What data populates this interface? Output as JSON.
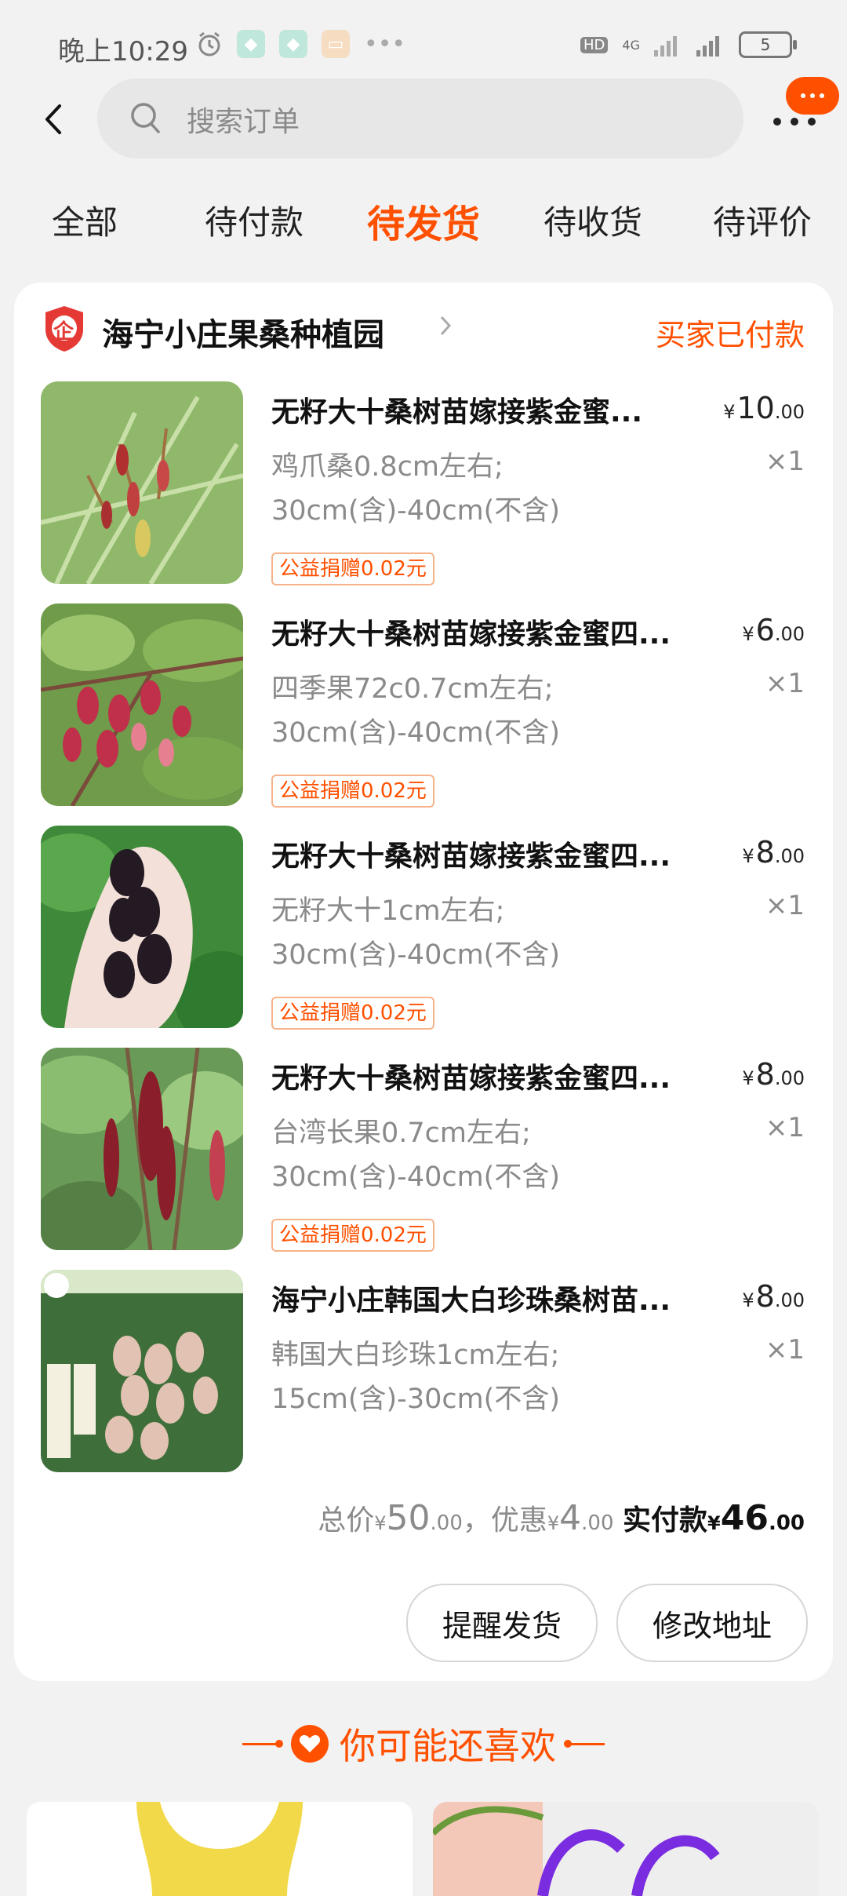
{
  "status_bar": {
    "time": "晚上10:29",
    "network_hd": "HD",
    "network_4g": "4G",
    "battery": "5"
  },
  "search": {
    "placeholder": "搜索订单"
  },
  "tabs": [
    {
      "label": "全部"
    },
    {
      "label": "待付款"
    },
    {
      "label": "待发货",
      "active": true
    },
    {
      "label": "待收货"
    },
    {
      "label": "待评价"
    }
  ],
  "order": {
    "shop_badge": "企",
    "shop_name": "海宁小庄果桑种植园",
    "status": "买家已付款",
    "items": [
      {
        "title": "无籽大十桑树苗嫁接紫金蜜...",
        "price_int": "10",
        "price_dec": ".00",
        "sku1": "鸡爪桑0.8cm左右;",
        "sku2": "30cm(含)-40cm(不含)",
        "qty": "×1",
        "donation": "公益捐赠0.02元"
      },
      {
        "title": "无籽大十桑树苗嫁接紫金蜜四...",
        "price_int": "6",
        "price_dec": ".00",
        "sku1": "四季果72c0.7cm左右;",
        "sku2": "30cm(含)-40cm(不含)",
        "qty": "×1",
        "donation": "公益捐赠0.02元"
      },
      {
        "title": "无籽大十桑树苗嫁接紫金蜜四...",
        "price_int": "8",
        "price_dec": ".00",
        "sku1": "无籽大十1cm左右;",
        "sku2": "30cm(含)-40cm(不含)",
        "qty": "×1",
        "donation": "公益捐赠0.02元"
      },
      {
        "title": "无籽大十桑树苗嫁接紫金蜜四...",
        "price_int": "8",
        "price_dec": ".00",
        "sku1": "台湾长果0.7cm左右;",
        "sku2": "30cm(含)-40cm(不含)",
        "qty": "×1",
        "donation": "公益捐赠0.02元"
      },
      {
        "title": "海宁小庄韩国大白珍珠桑树苗...",
        "price_int": "8",
        "price_dec": ".00",
        "sku1": "韩国大白珍珠1cm左右;",
        "sku2": "15cm(含)-30cm(不含)",
        "qty": "×1"
      }
    ],
    "total": {
      "total_label": "总价",
      "total_int": "50",
      "total_dec": ".00",
      "discount_label": "，优惠",
      "discount_int": "4",
      "discount_dec": ".00",
      "paid_label": "实付款",
      "paid_int": "46",
      "paid_dec": ".00",
      "currency": "¥"
    },
    "buttons": {
      "remind": "提醒发货",
      "change_address": "修改地址"
    }
  },
  "recommend": {
    "title": "你可能还喜欢"
  },
  "colors": {
    "accent": "#ff5000",
    "background": "#f2f2f2"
  }
}
